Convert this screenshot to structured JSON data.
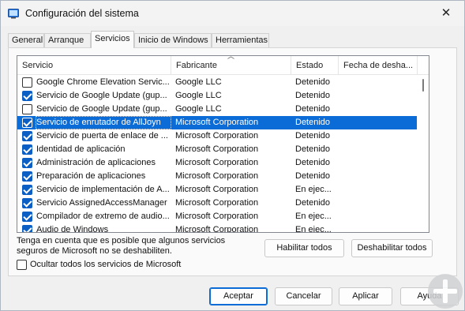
{
  "window": {
    "title": "Configuración del sistema",
    "close_glyph": "✕",
    "accent": "#0b6cd7"
  },
  "tabs": [
    {
      "label": "General"
    },
    {
      "label": "Arranque"
    },
    {
      "label": "Servicios",
      "active": true
    },
    {
      "label": "Inicio de Windows"
    },
    {
      "label": "Herramientas"
    }
  ],
  "table": {
    "headers": {
      "service": "Servicio",
      "manufacturer": "Fabricante",
      "state": "Estado",
      "disabled_date": "Fecha de desha..."
    },
    "sorted_column": "manufacturer",
    "rows": [
      {
        "checked": false,
        "name": "Google Chrome Elevation Servic...",
        "manufacturer": "Google LLC",
        "state": "Detenido"
      },
      {
        "checked": true,
        "name": "Servicio de Google Update (gup...",
        "manufacturer": "Google LLC",
        "state": "Detenido"
      },
      {
        "checked": false,
        "name": "Servicio de Google Update (gup...",
        "manufacturer": "Google LLC",
        "state": "Detenido"
      },
      {
        "checked": true,
        "name": "Servicio de enrutador de AllJoyn",
        "manufacturer": "Microsoft Corporation",
        "state": "Detenido",
        "selected": true
      },
      {
        "checked": true,
        "name": "Servicio de puerta de enlace de ...",
        "manufacturer": "Microsoft Corporation",
        "state": "Detenido"
      },
      {
        "checked": true,
        "name": "Identidad de aplicación",
        "manufacturer": "Microsoft Corporation",
        "state": "Detenido"
      },
      {
        "checked": true,
        "name": "Administración de aplicaciones",
        "manufacturer": "Microsoft Corporation",
        "state": "Detenido"
      },
      {
        "checked": true,
        "name": "Preparación de aplicaciones",
        "manufacturer": "Microsoft Corporation",
        "state": "Detenido"
      },
      {
        "checked": true,
        "name": "Servicio de implementación de A...",
        "manufacturer": "Microsoft Corporation",
        "state": "En ejec..."
      },
      {
        "checked": true,
        "name": "Servicio AssignedAccessManager",
        "manufacturer": "Microsoft Corporation",
        "state": "Detenido"
      },
      {
        "checked": true,
        "name": "Compilador de extremo de audio...",
        "manufacturer": "Microsoft Corporation",
        "state": "En ejec..."
      },
      {
        "checked": true,
        "name": "Audio de Windows",
        "manufacturer": "Microsoft Corporation",
        "state": "En ejec..."
      }
    ]
  },
  "note": "Tenga en cuenta que es posible que algunos servicios seguros de Microsoft no se deshabiliten.",
  "buttons": {
    "enable_all": "Habilitar todos",
    "disable_all": "Deshabilitar todos",
    "ok": "Aceptar",
    "cancel": "Cancelar",
    "apply": "Aplicar",
    "help": "Ayuda"
  },
  "hide_microsoft": {
    "label": "Ocultar todos los servicios de Microsoft",
    "checked": false
  }
}
